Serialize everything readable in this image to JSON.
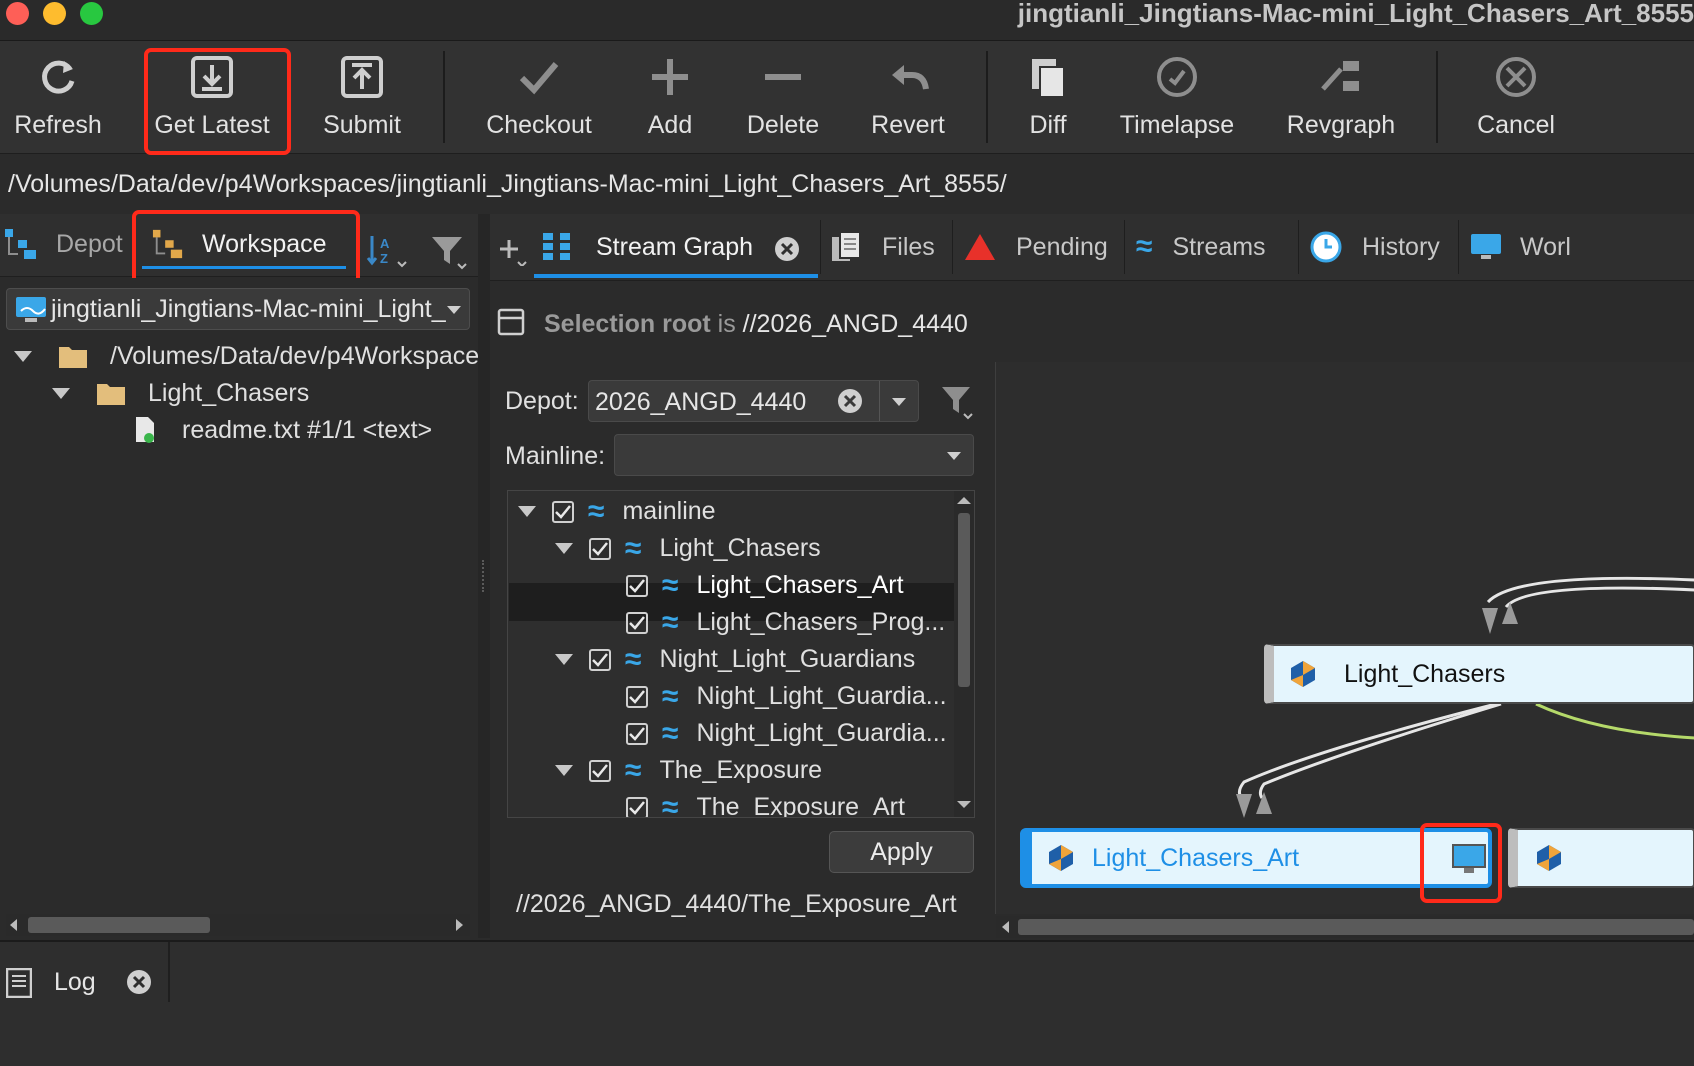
{
  "window": {
    "title": "jingtianli_Jingtians-Mac-mini_Light_Chasers_Art_8555"
  },
  "toolbar": {
    "buttons": [
      {
        "label": "Refresh",
        "icon": "refresh-icon"
      },
      {
        "label": "Get Latest",
        "icon": "download-icon"
      },
      {
        "label": "Submit",
        "icon": "upload-icon"
      },
      {
        "label": "Checkout",
        "icon": "checkmark-icon"
      },
      {
        "label": "Add",
        "icon": "plus-icon"
      },
      {
        "label": "Delete",
        "icon": "minus-icon"
      },
      {
        "label": "Revert",
        "icon": "undo-icon"
      },
      {
        "label": "Diff",
        "icon": "diff-icon"
      },
      {
        "label": "Timelapse",
        "icon": "timelapse-icon"
      },
      {
        "label": "Revgraph",
        "icon": "revgraph-icon"
      },
      {
        "label": "Cancel",
        "icon": "cancel-icon"
      }
    ]
  },
  "path_bar": {
    "value": "/Volumes/Data/dev/p4Workspaces/jingtianli_Jingtians-Mac-mini_Light_Chasers_Art_8555/"
  },
  "left_tabs": {
    "depot": "Depot",
    "workspace": "Workspace"
  },
  "workspace_panel": {
    "selected_workspace": "jingtianli_Jingtians-Mac-mini_Light_",
    "tree": [
      {
        "label": "/Volumes/Data/dev/p4Workspace",
        "type": "folder",
        "expanded": true
      },
      {
        "label": "Light_Chasers",
        "type": "folder",
        "expanded": true
      },
      {
        "label": "readme.txt #1/1 <text>",
        "type": "file"
      }
    ]
  },
  "right_tabs": [
    {
      "label": "Stream Graph",
      "icon": "stream-graph-icon",
      "active": true
    },
    {
      "label": "Files",
      "icon": "files-icon"
    },
    {
      "label": "Pending",
      "icon": "pending-icon"
    },
    {
      "label": "Streams",
      "icon": "streams-icon"
    },
    {
      "label": "History",
      "icon": "history-icon"
    },
    {
      "label": "Worl",
      "icon": "workspaces-icon"
    }
  ],
  "stream_graph": {
    "selection_root_label": "Selection root",
    "selection_root_is": "is",
    "selection_root_value": "//2026_ANGD_4440",
    "depot_label": "Depot:",
    "depot_value": "2026_ANGD_4440",
    "mainline_label": "Mainline:",
    "mainline_value": "",
    "streams": [
      {
        "label": "mainline",
        "level": 0,
        "checked": true,
        "expanded": true
      },
      {
        "label": "Light_Chasers",
        "level": 1,
        "checked": true,
        "expanded": true
      },
      {
        "label": "Light_Chasers_Art",
        "level": 2,
        "checked": true,
        "selected": true
      },
      {
        "label": "Light_Chasers_Prog...",
        "level": 2,
        "checked": true
      },
      {
        "label": "Night_Light_Guardians",
        "level": 1,
        "checked": true,
        "expanded": true
      },
      {
        "label": "Night_Light_Guardia...",
        "level": 2,
        "checked": true
      },
      {
        "label": "Night_Light_Guardia...",
        "level": 2,
        "checked": true
      },
      {
        "label": "The_Exposure",
        "level": 1,
        "checked": true,
        "expanded": true
      },
      {
        "label": "The_Exposure_Art",
        "level": 2,
        "checked": true
      }
    ],
    "apply_label": "Apply",
    "selected_path": "//2026_ANGD_4440/The_Exposure_Art",
    "nodes": {
      "parent": "Light_Chasers",
      "child": "Light_Chasers_Art"
    }
  },
  "bottom": {
    "log_label": "Log"
  },
  "colors": {
    "accent_blue": "#1e8fe6",
    "highlight_red": "#ff2a1a",
    "stream_blue": "#3aa7e8"
  }
}
